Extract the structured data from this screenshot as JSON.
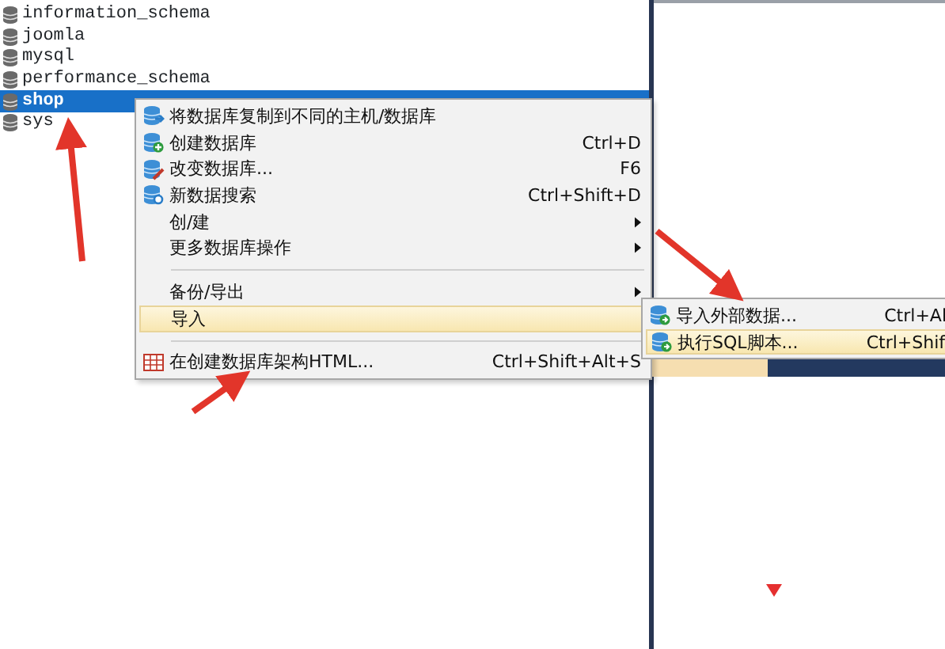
{
  "databases": [
    {
      "name": "information_schema",
      "selected": false
    },
    {
      "name": "joomla",
      "selected": false
    },
    {
      "name": "mysql",
      "selected": false
    },
    {
      "name": "performance_schema",
      "selected": false
    },
    {
      "name": "shop",
      "selected": true
    },
    {
      "name": "sys",
      "selected": false
    }
  ],
  "context_menu": [
    {
      "kind": "copy",
      "label": "将数据库复制到不同的主机/数据库",
      "selected": false
    },
    {
      "kind": "create",
      "label": "创建数据库",
      "shortcut": "Ctrl+D",
      "selected": false
    },
    {
      "kind": "edit",
      "label": "改变数据库...",
      "shortcut": "F6",
      "selected": false
    },
    {
      "kind": "search",
      "label": "新数据搜索",
      "shortcut": "Ctrl+Shift+D",
      "selected": false
    },
    {
      "kind": "submenu",
      "label": "创/建",
      "selected": false
    },
    {
      "kind": "submenu",
      "label": "更多数据库操作",
      "selected": false
    },
    {
      "kind": "separator"
    },
    {
      "kind": "submenu",
      "label": "备份/导出",
      "selected": false
    },
    {
      "kind": "plain",
      "label": "导入",
      "selected": true
    },
    {
      "kind": "separator"
    },
    {
      "kind": "html",
      "label": "在创建数据库架构HTML...",
      "shortcut": "Ctrl+Shift+Alt+S",
      "selected": false
    }
  ],
  "import_submenu": [
    {
      "label": "导入外部数据...",
      "shortcut": "Ctrl+Al",
      "selected": false
    },
    {
      "label": "执行SQL脚本...",
      "shortcut": "Ctrl+Shif",
      "selected": true
    }
  ]
}
